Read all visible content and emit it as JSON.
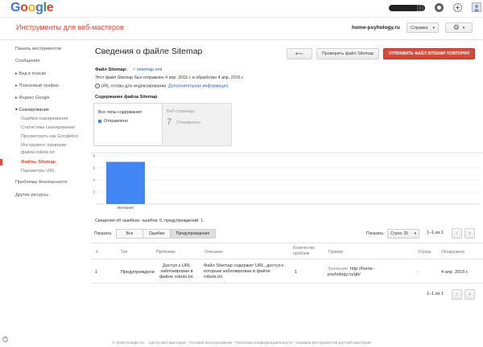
{
  "topbar": {
    "logo_letters": [
      {
        "ch": "G",
        "color": "#3b73e8"
      },
      {
        "ch": "o",
        "color": "#e4402f"
      },
      {
        "ch": "o",
        "color": "#f5b400"
      },
      {
        "ch": "g",
        "color": "#3b73e8"
      },
      {
        "ch": "l",
        "color": "#2f9e41"
      },
      {
        "ch": "e",
        "color": "#e4402f"
      }
    ],
    "icons": [
      "apps-icon",
      "notifications-icon",
      "share-plus-icon",
      "account-avatar"
    ]
  },
  "header": {
    "title": "Инструменты для веб-мастеров",
    "site": "home-psyhology.ru",
    "help_label": "Справка",
    "gear_caret": "▾"
  },
  "sidebar": {
    "items": [
      {
        "label": "Панель инструментов",
        "top": 58
      },
      {
        "label": "Сообщения",
        "top": 73
      }
    ],
    "groups": [
      {
        "label": "▸ Вид в поиске",
        "top": 89
      },
      {
        "label": "▸ Поисковый трафик",
        "top": 104
      },
      {
        "label": "▸ Индекс Google",
        "top": 119
      },
      {
        "label": "▾ Сканирование",
        "top": 134
      }
    ],
    "crawl_sub": [
      "Ошибки сканирования",
      "Статистика сканирования",
      "Просмотреть как Googlebot",
      "Инструмент проверки",
      "файла robots.txt",
      "Файлы Sitemap",
      "Параметры URL"
    ],
    "bottom": [
      "Проблемы безопасности",
      "Другие ресурсы"
    ],
    "help_icon": "?"
  },
  "main": {
    "title": "Сведения о файле Sitemap",
    "back_label": "⟵",
    "check_label": "Проверить файл Sitemap",
    "resubmit_label": "ОТПРАВИТЬ ФАЙЛ SITEMAP ПОВТОРНО",
    "sitemap_label": "Файл Sitemap:",
    "sitemap_link": "/sitemap.xml",
    "sent_text": "Этот файл Sitemap был отправлен 4 апр. 2015 г. и обработан 4 апр. 2015 г.",
    "ready_text": "URL готовы для индексирования.",
    "more_link": "Дополнительная информация.",
    "content_heading": "Содержание файла Sitemap",
    "panel_all": {
      "title": "Все типы содержания",
      "legend": "Отправлено"
    },
    "panel_web": {
      "title": "Веб-страницы",
      "count": "7",
      "label": "Отправлено"
    },
    "accent": "#4285f4",
    "errors_summary": "Сведения об ошибках: ошибок: 0, предупреждений: 1.",
    "show_label": "Показать:",
    "filters": [
      "Все",
      "Ошибки",
      "Предупреждения"
    ],
    "rows_label": "Строк:",
    "rows_value": "25",
    "pager": "1–1 из 1",
    "pager_bottom": "1–1 из 1"
  },
  "chart_data": {
    "type": "bar",
    "categories": [
      "Интернет"
    ],
    "values": [
      7
    ],
    "yticks": [
      2,
      4,
      6,
      8
    ],
    "ylim": [
      0,
      8
    ],
    "color": "#4285f4"
  },
  "table": {
    "headers": [
      "#",
      "Тип",
      "Проблема",
      "Описание",
      "Количество проблем",
      "Пример",
      "Строка",
      "Обнаружено"
    ],
    "rows": [
      {
        "num": "1",
        "type": "Предупреждение",
        "problem": "Доступ к URL заблокирован в файле robots.txt.",
        "description": "Файл Sitemap содержит URL, доступ к которым заблокирован в файле robots.txt.",
        "count": "1",
        "example_label": "Значение:",
        "example_value": "http://home-psyhology.ru/gb/",
        "line": "-",
        "detected": "4 апр. 2015 г."
      }
    ]
  },
  "footer": "© 2015 Google Inc. - Центр веб-мастеров - Условия использования - Политика конфиденциальности - Справка Инструментов для веб-мастеров"
}
